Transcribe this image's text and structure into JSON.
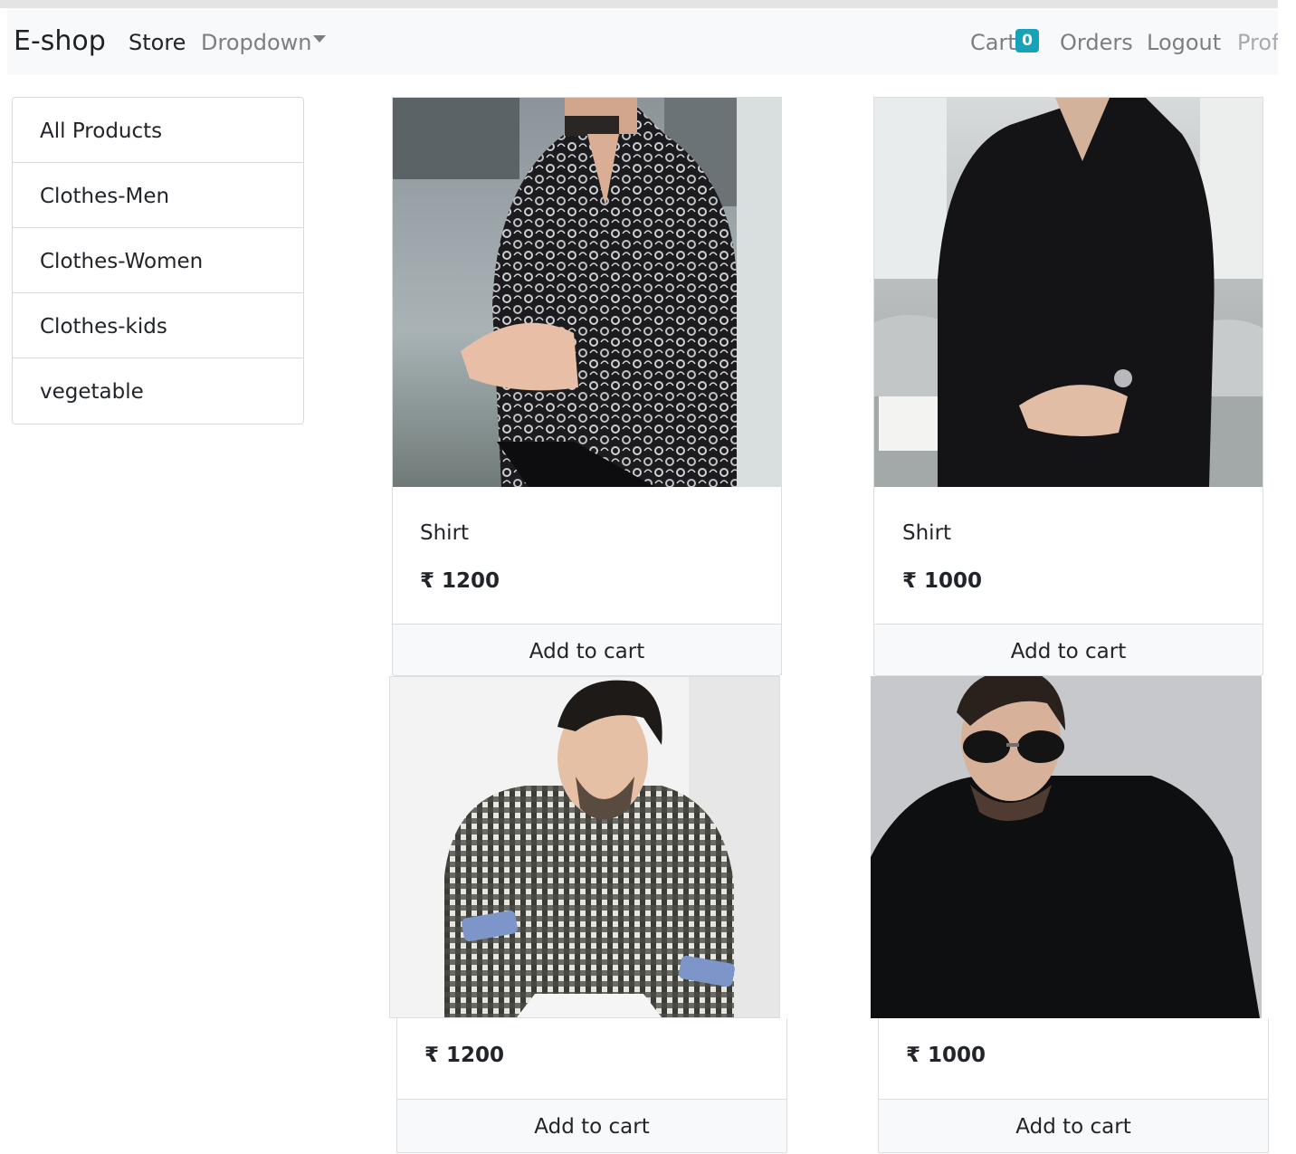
{
  "navbar": {
    "brand": "E-shop",
    "links": {
      "store": "Store",
      "dropdown": "Dropdown",
      "cart": "Cart",
      "cart_count": "0",
      "orders": "Orders",
      "logout": "Logout",
      "profile": "Prof"
    }
  },
  "sidebar": {
    "items": [
      {
        "label": "All Products"
      },
      {
        "label": "Clothes-Men"
      },
      {
        "label": "Clothes-Women"
      },
      {
        "label": "Clothes-kids"
      },
      {
        "label": "vegetable"
      }
    ]
  },
  "products": [
    {
      "title": "Shirt",
      "price": "₹ 1200",
      "button": "Add to cart",
      "image": "floral-print-black-shirt-photo"
    },
    {
      "title": "Shirt",
      "price": "₹ 1000",
      "button": "Add to cart",
      "image": "plain-black-shirt-photo"
    },
    {
      "price": "₹ 1200",
      "button": "Add to cart",
      "image": "checkered-shirt-man-photo"
    },
    {
      "price": "₹ 1000",
      "button": "Add to cart",
      "image": "black-shirt-sunglasses-man-photo"
    }
  ],
  "colors": {
    "navbar_bg": "#f8f9fa",
    "badge": "#17a2b8",
    "muted_link": "#7b7f83",
    "border": "#dcdfe2"
  }
}
